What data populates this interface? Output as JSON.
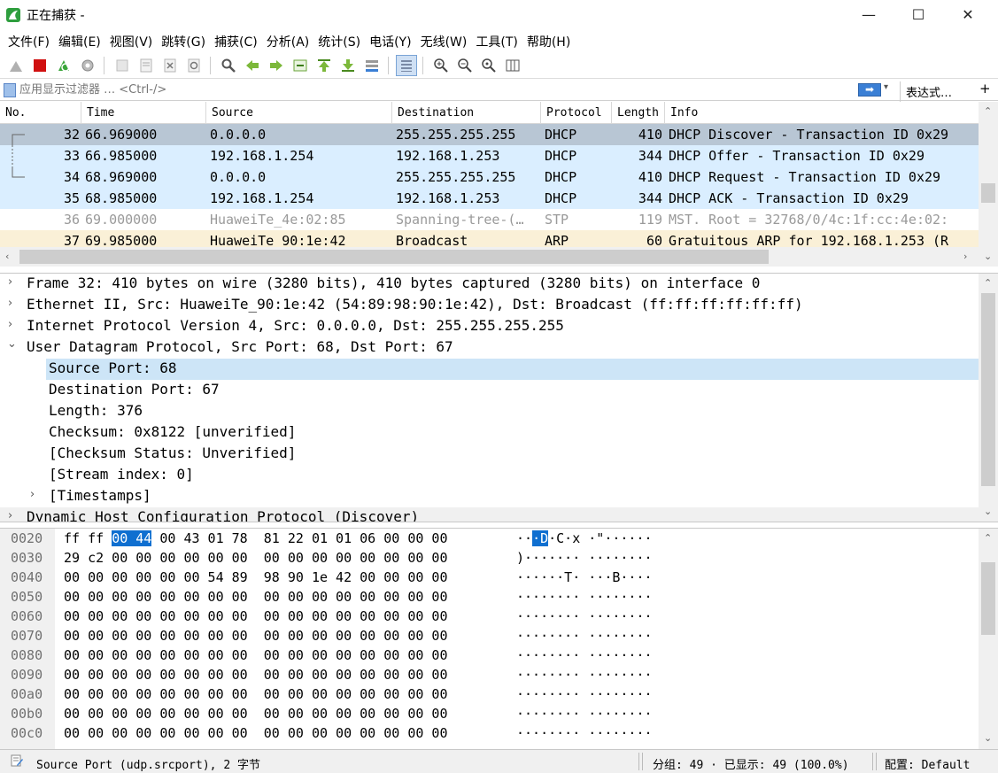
{
  "window": {
    "title": "正在捕获 -",
    "minimize": "—",
    "maximize": "☐",
    "close": "✕"
  },
  "menu": [
    "文件(F)",
    "编辑(E)",
    "视图(V)",
    "跳转(G)",
    "捕获(C)",
    "分析(A)",
    "统计(S)",
    "电话(Y)",
    "无线(W)",
    "工具(T)",
    "帮助(H)"
  ],
  "filter": {
    "placeholder": "应用显示过滤器 … <Ctrl-/>",
    "apply": "➡",
    "dropdown": "▾",
    "expression_label": "表达式…",
    "add": "+"
  },
  "columns": {
    "no": "No.",
    "time": "Time",
    "source": "Source",
    "destination": "Destination",
    "protocol": "Protocol",
    "length": "Length",
    "info": "Info"
  },
  "packets": [
    {
      "no": "32",
      "time": "66.969000",
      "src": "0.0.0.0",
      "dst": "255.255.255.255",
      "proto": "DHCP",
      "len": "410",
      "info": "DHCP Discover - Transaction ID 0x29"
    },
    {
      "no": "33",
      "time": "66.985000",
      "src": "192.168.1.254",
      "dst": "192.168.1.253",
      "proto": "DHCP",
      "len": "344",
      "info": "DHCP Offer    - Transaction ID 0x29"
    },
    {
      "no": "34",
      "time": "68.969000",
      "src": "0.0.0.0",
      "dst": "255.255.255.255",
      "proto": "DHCP",
      "len": "410",
      "info": "DHCP Request  - Transaction ID 0x29"
    },
    {
      "no": "35",
      "time": "68.985000",
      "src": "192.168.1.254",
      "dst": "192.168.1.253",
      "proto": "DHCP",
      "len": "344",
      "info": "DHCP ACK      - Transaction ID 0x29"
    },
    {
      "no": "36",
      "time": "69.000000",
      "src": "HuaweiTe_4e:02:85",
      "dst": "Spanning-tree-(…",
      "proto": "STP",
      "len": "119",
      "info": "MST. Root = 32768/0/4c:1f:cc:4e:02:"
    },
    {
      "no": "37",
      "time": "69.985000",
      "src": "HuaweiTe_90:1e:42",
      "dst": "Broadcast",
      "proto": "ARP",
      "len": "60",
      "info": "Gratuitous ARP for 192.168.1.253 (R"
    }
  ],
  "row_colors": {
    "selected": "#b8c6d4",
    "dhcp": "#daeeff",
    "stp": "#ffffff",
    "arp": "#faf0d7",
    "stp_text": "#9a9a9a"
  },
  "details": [
    {
      "arrow": "›",
      "text": "Frame 32: 410 bytes on wire (3280 bits), 410 bytes captured (3280 bits) on interface 0"
    },
    {
      "arrow": "›",
      "text": "Ethernet II, Src: HuaweiTe_90:1e:42 (54:89:98:90:1e:42), Dst: Broadcast (ff:ff:ff:ff:ff:ff)"
    },
    {
      "arrow": "›",
      "text": "Internet Protocol Version 4, Src: 0.0.0.0, Dst: 255.255.255.255"
    },
    {
      "arrow": "⌄",
      "text": "User Datagram Protocol, Src Port: 68, Dst Port: 67"
    },
    {
      "arrow": "",
      "text": "Source Port: 68"
    },
    {
      "arrow": "",
      "text": "Destination Port: 67"
    },
    {
      "arrow": "",
      "text": "Length: 376"
    },
    {
      "arrow": "",
      "text": "Checksum: 0x8122 [unverified]"
    },
    {
      "arrow": "",
      "text": "[Checksum Status: Unverified]"
    },
    {
      "arrow": "",
      "text": "[Stream index: 0]"
    },
    {
      "arrow": "›",
      "text": "[Timestamps]"
    },
    {
      "arrow": "›",
      "text": "Dynamic Host Configuration Protocol (Discover)"
    }
  ],
  "bytes": [
    {
      "off": "0020",
      "hex_pre": "ff ff ",
      "hex_hl": "00 44",
      "hex_post": " 00 43 01 78  81 22 01 01 06 00 00 00",
      "asc_pre": "··",
      "asc_hl": "·D",
      "asc_post": "·C·x ·\"······"
    },
    {
      "off": "0030",
      "hex": "29 c2 00 00 00 00 00 00  00 00 00 00 00 00 00 00",
      "asc": ")······· ········"
    },
    {
      "off": "0040",
      "hex": "00 00 00 00 00 00 54 89  98 90 1e 42 00 00 00 00",
      "asc": "······T· ···B····"
    },
    {
      "off": "0050",
      "hex": "00 00 00 00 00 00 00 00  00 00 00 00 00 00 00 00",
      "asc": "········ ········"
    },
    {
      "off": "0060",
      "hex": "00 00 00 00 00 00 00 00  00 00 00 00 00 00 00 00",
      "asc": "········ ········"
    },
    {
      "off": "0070",
      "hex": "00 00 00 00 00 00 00 00  00 00 00 00 00 00 00 00",
      "asc": "········ ········"
    },
    {
      "off": "0080",
      "hex": "00 00 00 00 00 00 00 00  00 00 00 00 00 00 00 00",
      "asc": "········ ········"
    },
    {
      "off": "0090",
      "hex": "00 00 00 00 00 00 00 00  00 00 00 00 00 00 00 00",
      "asc": "········ ········"
    },
    {
      "off": "00a0",
      "hex": "00 00 00 00 00 00 00 00  00 00 00 00 00 00 00 00",
      "asc": "········ ········"
    },
    {
      "off": "00b0",
      "hex": "00 00 00 00 00 00 00 00  00 00 00 00 00 00 00 00",
      "asc": "········ ········"
    },
    {
      "off": "00c0",
      "hex": "00 00 00 00 00 00 00 00  00 00 00 00 00 00 00 00",
      "asc": "········ ········"
    }
  ],
  "status": {
    "field": "Source Port (udp.srcport), 2 字节",
    "counts": "分组: 49 · 已显示: 49 (100.0%)",
    "profile": "配置: Default"
  },
  "toolbar_icons": [
    "shark-fin-icon",
    "stop-capture-icon",
    "restart-capture-icon",
    "capture-options-icon",
    "open-file-icon",
    "save-file-icon",
    "close-file-icon",
    "reload-file-icon",
    "find-packet-icon",
    "go-back-icon",
    "go-forward-icon",
    "go-to-packet-icon",
    "first-packet-icon",
    "last-packet-icon",
    "auto-scroll-icon",
    "colorize-icon",
    "zoom-in-icon",
    "zoom-out-icon",
    "normal-size-icon",
    "resize-columns-icon"
  ]
}
